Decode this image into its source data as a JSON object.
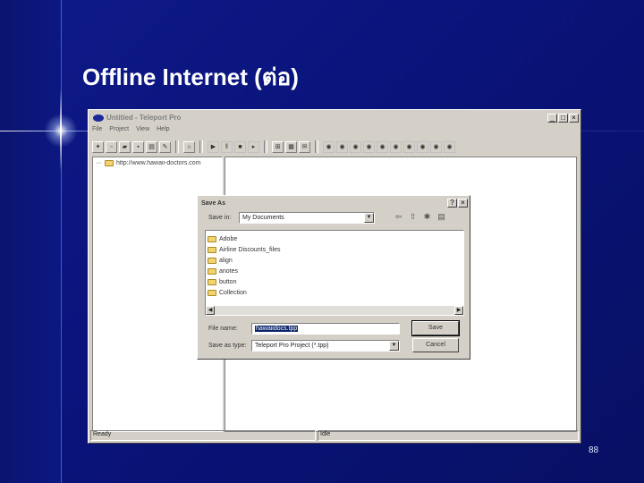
{
  "slide": {
    "title": "Offline Internet (ต่อ)",
    "number": "88",
    "colors": {
      "background": "#0b1580",
      "title": "#ffffff"
    }
  },
  "app": {
    "title": "Untitled - Teleport Pro",
    "menu": [
      "File",
      "Project",
      "View",
      "Help"
    ],
    "tree_item": "http://www.hawaii-doctors.com",
    "status_left": "Ready",
    "status_right": "Idle"
  },
  "dialog": {
    "title": "Save As",
    "save_in_label": "Save in:",
    "save_in_value": "My Documents",
    "folders": [
      "Adobe",
      "Airline Discounts_files",
      "align",
      "anotes",
      "button",
      "Collection"
    ],
    "file_name_label": "File name:",
    "file_name_value": "hawaiidocs.tpp",
    "save_as_type_label": "Save as type:",
    "save_as_type_value": "Teleport Pro Project (*.tpp)",
    "save_button": "Save",
    "cancel_button": "Cancel"
  }
}
